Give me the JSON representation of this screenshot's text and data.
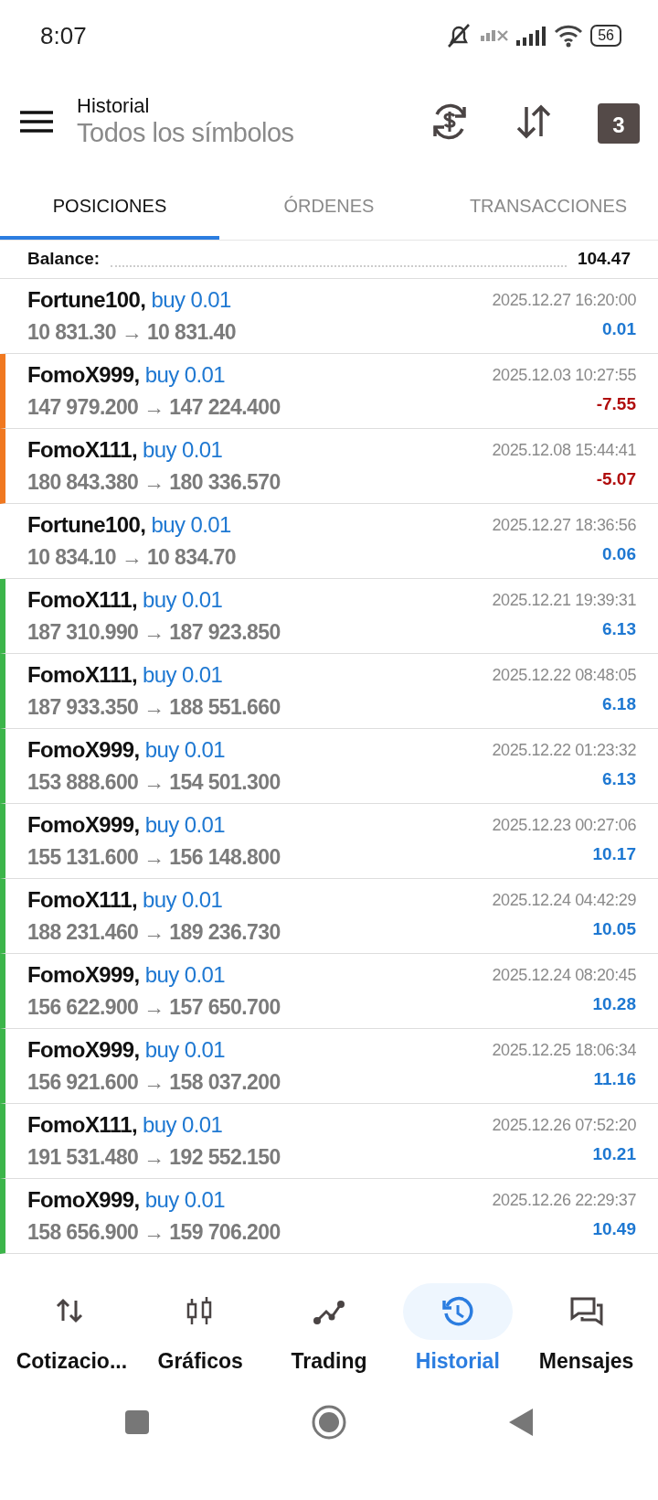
{
  "status_bar": {
    "time": "8:07",
    "battery": "56"
  },
  "header": {
    "title": "Historial",
    "subtitle": "Todos los símbolos",
    "calendar_day": "3"
  },
  "tabs": [
    {
      "label": "POSICIONES",
      "selected": true
    },
    {
      "label": "ÓRDENES",
      "selected": false
    },
    {
      "label": "TRANSACCIONES",
      "selected": false
    }
  ],
  "balance": {
    "label": "Balance:",
    "value": "104.47"
  },
  "deals": [
    {
      "symbol": "Fortune100,",
      "side": "buy 0.01",
      "prices": "10 831.30 → 10 831.40",
      "time": "2025.12.27 16:20:00",
      "profit": "0.01",
      "kind": "gain"
    },
    {
      "symbol": "FomoX999,",
      "side": "buy 0.01",
      "prices": "147 979.200 → 147 224.400",
      "time": "2025.12.03 10:27:55",
      "profit": "-7.55",
      "kind": "loss",
      "color": "#f07820"
    },
    {
      "symbol": "FomoX111,",
      "side": "buy 0.01",
      "prices": "180 843.380 → 180 336.570",
      "time": "2025.12.08 15:44:41",
      "profit": "-5.07",
      "kind": "loss",
      "color": "#f07820"
    },
    {
      "symbol": "Fortune100,",
      "side": "buy 0.01",
      "prices": "10 834.10 → 10 834.70",
      "time": "2025.12.27 18:36:56",
      "profit": "0.06",
      "kind": "gain"
    },
    {
      "symbol": "FomoX111,",
      "side": "buy 0.01",
      "prices": "187 310.990 → 187 923.850",
      "time": "2025.12.21 19:39:31",
      "profit": "6.13",
      "kind": "gain",
      "color": "#3cb54a"
    },
    {
      "symbol": "FomoX111,",
      "side": "buy 0.01",
      "prices": "187 933.350 → 188 551.660",
      "time": "2025.12.22 08:48:05",
      "profit": "6.18",
      "kind": "gain",
      "color": "#3cb54a"
    },
    {
      "symbol": "FomoX999,",
      "side": "buy 0.01",
      "prices": "153 888.600 → 154 501.300",
      "time": "2025.12.22 01:23:32",
      "profit": "6.13",
      "kind": "gain",
      "color": "#3cb54a"
    },
    {
      "symbol": "FomoX999,",
      "side": "buy 0.01",
      "prices": "155 131.600 → 156 148.800",
      "time": "2025.12.23 00:27:06",
      "profit": "10.17",
      "kind": "gain",
      "color": "#3cb54a"
    },
    {
      "symbol": "FomoX111,",
      "side": "buy 0.01",
      "prices": "188 231.460 → 189 236.730",
      "time": "2025.12.24 04:42:29",
      "profit": "10.05",
      "kind": "gain",
      "color": "#3cb54a"
    },
    {
      "symbol": "FomoX999,",
      "side": "buy 0.01",
      "prices": "156 622.900 → 157 650.700",
      "time": "2025.12.24 08:20:45",
      "profit": "10.28",
      "kind": "gain",
      "color": "#3cb54a"
    },
    {
      "symbol": "FomoX999,",
      "side": "buy 0.01",
      "prices": "156 921.600 → 158 037.200",
      "time": "2025.12.25 18:06:34",
      "profit": "11.16",
      "kind": "gain",
      "color": "#3cb54a"
    },
    {
      "symbol": "FomoX111,",
      "side": "buy 0.01",
      "prices": "191 531.480 → 192 552.150",
      "time": "2025.12.26 07:52:20",
      "profit": "10.21",
      "kind": "gain",
      "color": "#3cb54a"
    },
    {
      "symbol": "FomoX999,",
      "side": "buy 0.01",
      "prices": "158 656.900 → 159 706.200",
      "time": "2025.12.26 22:29:37",
      "profit": "10.49",
      "kind": "gain",
      "color": "#3cb54a"
    }
  ],
  "bottom_nav": [
    {
      "label": "Cotizacio...",
      "selected": false
    },
    {
      "label": "Gráficos",
      "selected": false
    },
    {
      "label": "Trading",
      "selected": false
    },
    {
      "label": "Historial",
      "selected": true
    },
    {
      "label": "Mensajes",
      "selected": false
    }
  ]
}
